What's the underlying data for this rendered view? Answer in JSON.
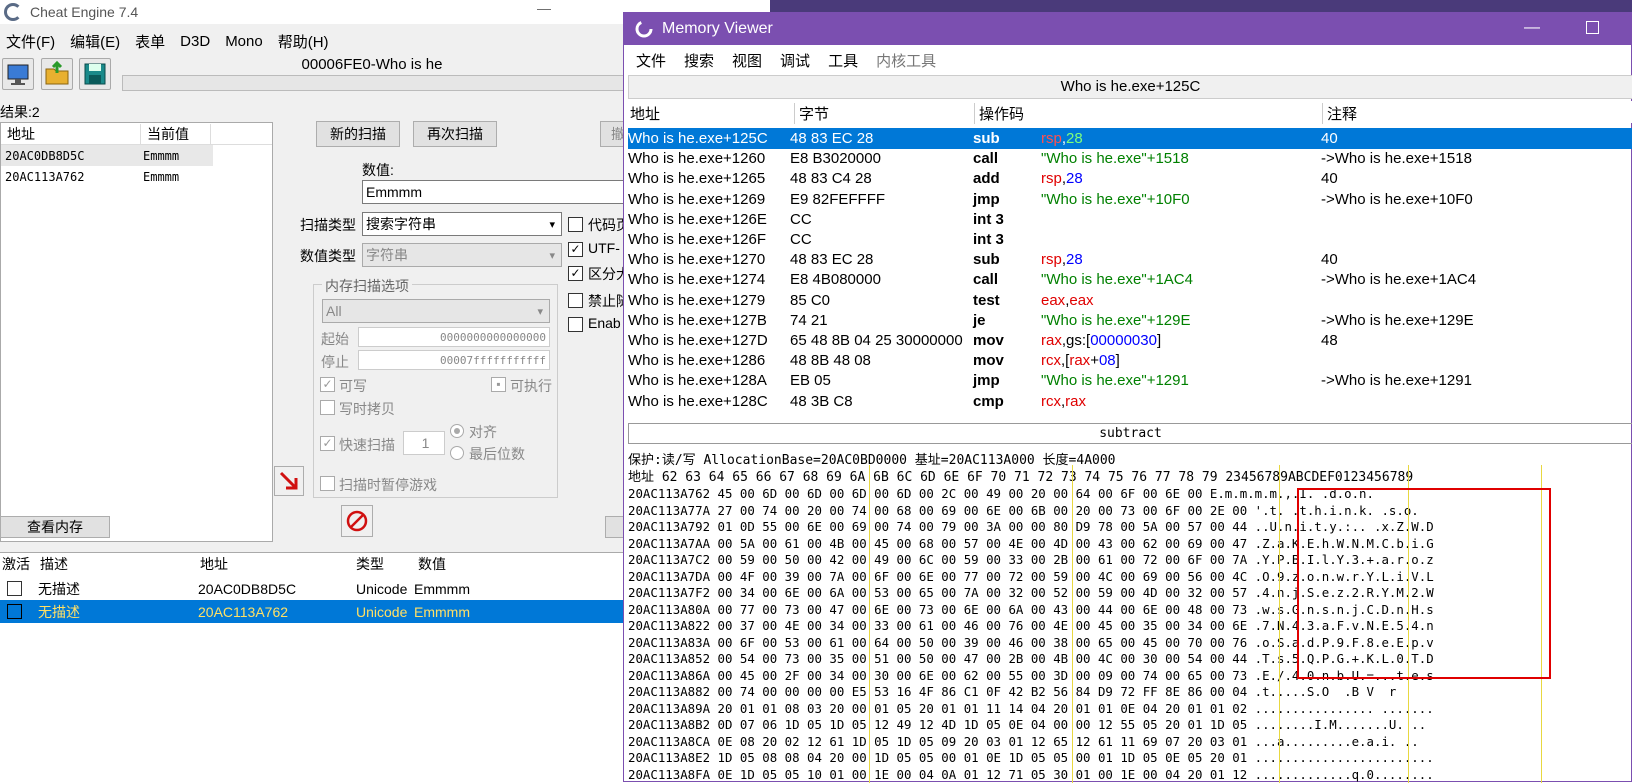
{
  "ce": {
    "title": "Cheat Engine 7.4",
    "min": "—",
    "menu": [
      "文件(F)",
      "编辑(E)",
      "表单",
      "D3D",
      "Mono",
      "帮助(H)"
    ],
    "process": "00006FE0-Who is he",
    "results_label": "结果:2",
    "found_headers": [
      "地址",
      "当前值"
    ],
    "found_rows": [
      {
        "addr": "20AC0DB8D5C",
        "val": "Emmmm"
      },
      {
        "addr": "20AC113A762",
        "val": "Emmmm"
      }
    ],
    "new_scan": "新的扫描",
    "next_scan": "再次扫描",
    "undo_scan_fragment": "撤",
    "value_label": "数值:",
    "value": "Emmmm",
    "scan_type_label": "扫描类型",
    "scan_type": "搜索字符串",
    "value_type_label": "数值类型",
    "value_type": "字符串",
    "code_cb": "代码页",
    "utf_cb": "UTF-",
    "case_cb": "区分大",
    "forbid_cb": "禁止随",
    "enable_cb": "Enab",
    "mem_opts": "内存扫描选项",
    "mem_all": "All",
    "start_label": "起始",
    "start": "0000000000000000",
    "stop_label": "停止",
    "stop": "00007fffffffffff",
    "writable": "可写",
    "executable": "可执行",
    "cow": "写时拷贝",
    "fast_scan": "快速扫描",
    "fast_val": "1",
    "align": "对齐",
    "last_digit": "最后位数",
    "pause": "扫描时暂停游戏",
    "view_memory": "查看内存",
    "addr_headers": [
      "激活",
      "描述",
      "地址",
      "类型",
      "数值"
    ],
    "addr_rows": [
      {
        "desc": "无描述",
        "addr": "20AC0DB8D5C",
        "type": "Unicode",
        "val": "Emmmm"
      },
      {
        "desc": "无描述",
        "addr": "20AC113A762",
        "type": "Unicode",
        "val": "Emmmm"
      }
    ]
  },
  "mv": {
    "title": "Memory Viewer",
    "menu": [
      "文件",
      "搜索",
      "视图",
      "调试",
      "工具",
      "内核工具"
    ],
    "header": "Who is he.exe+125C",
    "cols": [
      "地址",
      "字节",
      "操作码",
      "注释"
    ],
    "rows": [
      {
        "addr": "Who is he.exe+125C",
        "bytes": "48 83 EC 28",
        "op": "sub",
        "args": [
          [
            "rsp",
            "red"
          ],
          [
            ",",
            ""
          ],
          [
            "28",
            "green"
          ]
        ],
        "comment": "40"
      },
      {
        "addr": "Who is he.exe+1260",
        "bytes": "E8 B3020000",
        "op": "call",
        "args": [
          [
            "\"Who is he.exe\"+1518",
            "green"
          ]
        ],
        "comment": "->Who is he.exe+1518"
      },
      {
        "addr": "Who is he.exe+1265",
        "bytes": "48 83 C4 28",
        "op": "add",
        "args": [
          [
            "rsp",
            "red"
          ],
          [
            ",",
            ""
          ],
          [
            "28",
            "blue"
          ]
        ],
        "comment": "40"
      },
      {
        "addr": "Who is he.exe+1269",
        "bytes": "E9 82FEFFFF",
        "op": "jmp",
        "args": [
          [
            "\"Who is he.exe\"+10F0",
            "green"
          ]
        ],
        "comment": "->Who is he.exe+10F0"
      },
      {
        "addr": "Who is he.exe+126E",
        "bytes": "CC",
        "op": "int 3",
        "args": [],
        "comment": ""
      },
      {
        "addr": "Who is he.exe+126F",
        "bytes": "CC",
        "op": "int 3",
        "args": [],
        "comment": ""
      },
      {
        "addr": "Who is he.exe+1270",
        "bytes": "48 83 EC 28",
        "op": "sub",
        "args": [
          [
            "rsp",
            "red"
          ],
          [
            ",",
            ""
          ],
          [
            "28",
            "blue"
          ]
        ],
        "comment": "40"
      },
      {
        "addr": "Who is he.exe+1274",
        "bytes": "E8 4B080000",
        "op": "call",
        "args": [
          [
            "\"Who is he.exe\"+1AC4",
            "green"
          ]
        ],
        "comment": "->Who is he.exe+1AC4"
      },
      {
        "addr": "Who is he.exe+1279",
        "bytes": "85 C0",
        "op": "test",
        "args": [
          [
            "eax",
            "red"
          ],
          [
            ",",
            ""
          ],
          [
            "eax",
            "red"
          ]
        ],
        "comment": ""
      },
      {
        "addr": "Who is he.exe+127B",
        "bytes": "74 21",
        "op": "je",
        "args": [
          [
            "\"Who is he.exe\"+129E",
            "green"
          ]
        ],
        "comment": "->Who is he.exe+129E"
      },
      {
        "addr": "Who is he.exe+127D",
        "bytes": "65 48 8B 04 25 30000000",
        "op": "mov",
        "args": [
          [
            "rax",
            "red"
          ],
          [
            ",gs:[",
            ""
          ],
          [
            "00000030",
            "blue"
          ],
          [
            "]",
            ""
          ]
        ],
        "comment": "48"
      },
      {
        "addr": "Who is he.exe+1286",
        "bytes": "48 8B 48 08",
        "op": "mov",
        "args": [
          [
            "rcx",
            "red"
          ],
          [
            ",[",
            ""
          ],
          [
            "rax",
            "red"
          ],
          [
            "+",
            ""
          ],
          [
            "08",
            "blue"
          ],
          [
            "]",
            ""
          ]
        ],
        "comment": ""
      },
      {
        "addr": "Who is he.exe+128A",
        "bytes": "EB 05",
        "op": "jmp",
        "args": [
          [
            "\"Who is he.exe\"+1291",
            "green"
          ]
        ],
        "comment": "->Who is he.exe+1291"
      },
      {
        "addr": "Who is he.exe+128C",
        "bytes": "48 3B C8",
        "op": "cmp",
        "args": [
          [
            "rcx",
            "red"
          ],
          [
            ",",
            ""
          ],
          [
            "rax",
            "red"
          ]
        ],
        "comment": ""
      }
    ],
    "status": "subtract",
    "hexinfo": "保护:读/写  AllocationBase=20AC0BD0000 基址=20AC113A000 长度=4A000",
    "hexhdr": "地址          62 63 64 65 66 67 68 69 6A 6B 6C 6D 6E 6F 70 71 72 73 74 75 76 77 78 79 23456789ABCDEF0123456789",
    "hexrows": [
      "20AC113A762 45 00 6D 00 6D 00 6D 00 6D 00 2C 00 49 00 20 00 64 00 6F 00 6E 00 E.m.m.m.m.,.I. .d.o.n.",
      "20AC113A77A 27 00 74 00 20 00 74 00 68 00 69 00 6E 00 6B 00 20 00 73 00 6F 00 2E 00 '.t. .t.h.i.n.k. .s.o.",
      "20AC113A792 01 0D 55 00 6E 00 69 00 74 00 79 00 3A 00 00 80 D9 78 00 5A 00 57 00 44 ..U.n.i.t.y.:.. .x.Z.W.D",
      "20AC113A7AA 00 5A 00 61 00 4B 00 45 00 68 00 57 00 4E 00 4D 00 43 00 62 00 69 00 47 .Z.a.K.E.h.W.N.M.C.b.i.G",
      "20AC113A7C2 00 59 00 50 00 42 00 49 00 6C 00 59 00 33 00 2B 00 61 00 72 00 6F 00 7A .Y.P.B.I.l.Y.3.+.a.r.o.z",
      "20AC113A7DA 00 4F 00 39 00 7A 00 6F 00 6E 00 77 00 72 00 59 00 4C 00 69 00 56 00 4C .O.9.z.o.n.w.r.Y.L.i.V.L",
      "20AC113A7F2 00 34 00 6E 00 6A 00 53 00 65 00 7A 00 32 00 52 00 59 00 4D 00 32 00 57 .4.n.j.S.e.z.2.R.Y.M.2.W",
      "20AC113A80A 00 77 00 73 00 47 00 6E 00 73 00 6E 00 6A 00 43 00 44 00 6E 00 48 00 73 .w.s.G.n.s.n.j.C.D.n.H.s",
      "20AC113A822 00 37 00 4E 00 34 00 33 00 61 00 46 00 76 00 4E 00 45 00 35 00 34 00 6E .7.N.4.3.a.F.v.N.E.5.4.n",
      "20AC113A83A 00 6F 00 53 00 61 00 64 00 50 00 39 00 46 00 38 00 65 00 45 00 70 00 76 .o.S.a.d.P.9.F.8.e.E.p.v",
      "20AC113A852 00 54 00 73 00 35 00 51 00 50 00 47 00 2B 00 4B 00 4C 00 30 00 54 00 44 .T.s.5.Q.P.G.+.K.L.0.T.D",
      "20AC113A86A 00 45 00 2F 00 34 00 30 00 6E 00 62 00 55 00 3D 00 09 00 74 00 65 00 73 .E./.4.0.n.b.U.=...t.e.s",
      "20AC113A882 00 74 00 00 00 00 E5 53 16 4F 86 C1 0F 42 B2 56 84 D9 72 FF 8E 86 00 04 .t.....S.O  .B V  r    ",
      "20AC113A89A 20 01 01 08 03 20 00 01 05 20 01 01 11 14 04 20 01 01 0E 04 20 01 01 02 ................ .......",
      "20AC113A8B2 0D 07 06 1D 05 1D 05 12 49 12 4D 1D 05 0E 04 00 00 12 55 05 20 01 1D 05 ........I.M.......U. ..",
      "20AC113A8CA 0E 08 20 02 12 61 1D 05 1D 05 09 20 03 01 12 65 12 61 11 69 07 20 03 01 ...a.........e.a.i. ..",
      "20AC113A8E2 1D 05 08 08 04 20 00 1D 05 05 00 01 0E 1D 05 05 00 01 1D 05 0E 05 20 01 ........................",
      "20AC113A8FA 0E 1D 05 05 10 01 00 1E 00 04 0A 01 12 71 05 30 01 00 1E 00 04 20 01 12 .............q.0........"
    ]
  }
}
